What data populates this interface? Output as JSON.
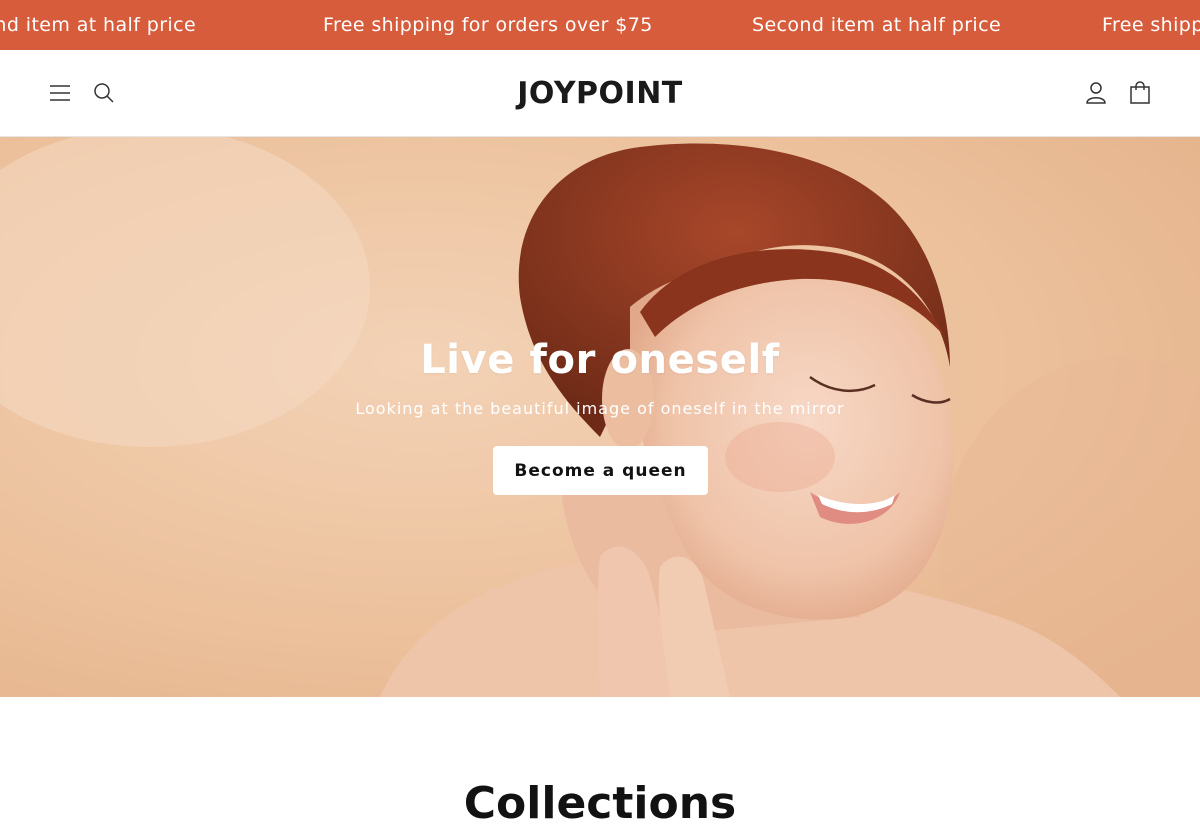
{
  "colors": {
    "announcement_bg": "#d65c3c",
    "announcement_text": "#ffffff",
    "hero_bg": "#eec6a4",
    "button_bg": "#ffffff",
    "button_text": "#121212"
  },
  "announcement": {
    "messages": [
      "Second item at half price",
      "Free shipping for orders over $75",
      "Second item at half price",
      "Free shipping for orders over $75"
    ]
  },
  "header": {
    "logo": "JOYPOINT",
    "icons": [
      "menu-icon",
      "search-icon",
      "account-icon",
      "cart-icon"
    ]
  },
  "hero": {
    "title": "Live for oneself",
    "subtitle": "Looking at the beautiful image of oneself in the mirror",
    "button_label": "Become a queen"
  },
  "collections": {
    "heading": "Collections"
  }
}
